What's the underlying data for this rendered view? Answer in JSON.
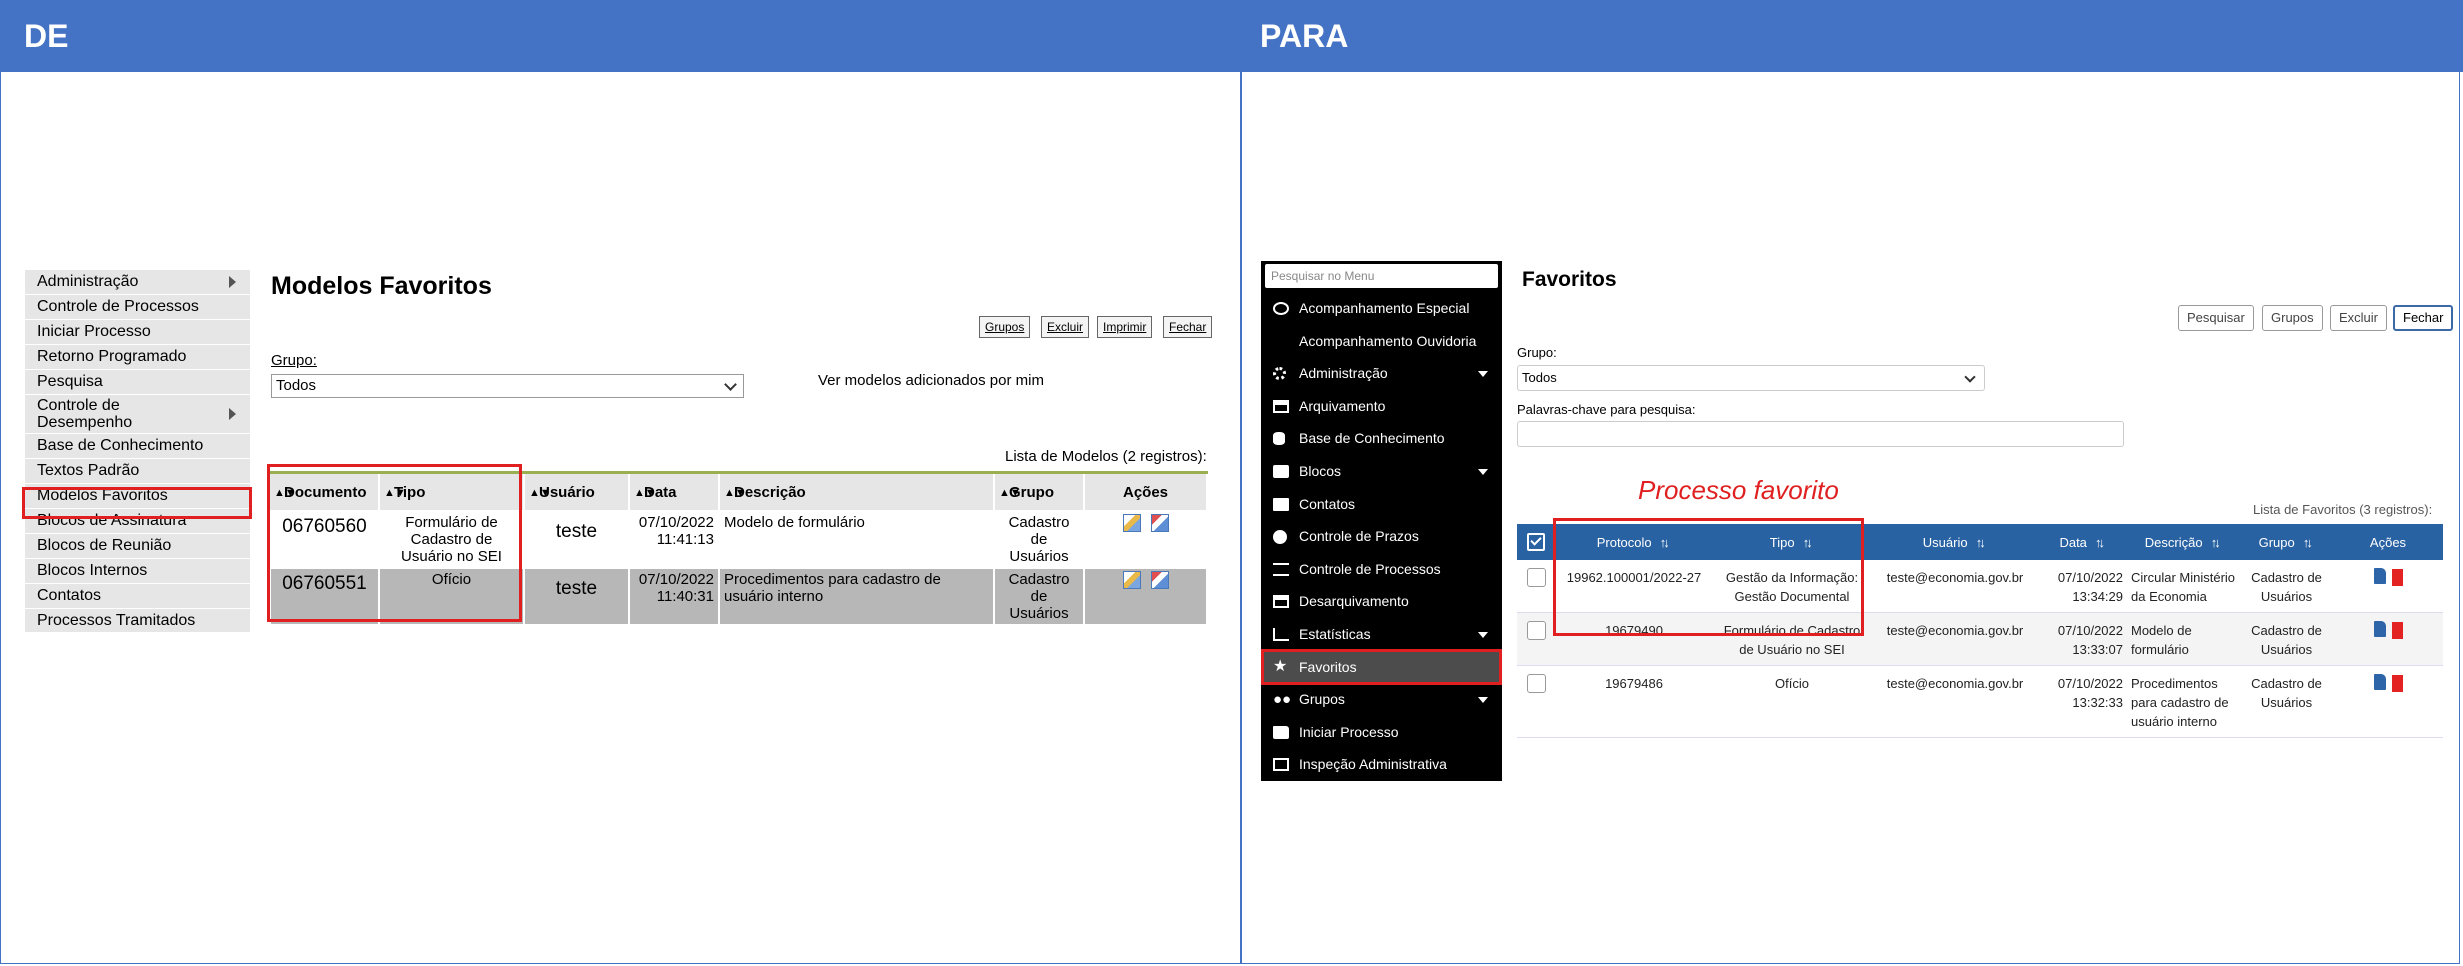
{
  "headers": {
    "left": "DE",
    "right": "PARA"
  },
  "old_ui": {
    "menu": [
      {
        "label": "Administração",
        "submenu": true
      },
      {
        "label": "Controle de Processos"
      },
      {
        "label": "Iniciar Processo"
      },
      {
        "label": "Retorno Programado"
      },
      {
        "label": "Pesquisa"
      },
      {
        "label": "Controle de Desempenho",
        "submenu": true
      },
      {
        "label": "Base de Conhecimento"
      },
      {
        "label": "Textos Padrão"
      },
      {
        "label": "Modelos Favoritos",
        "highlighted": true
      },
      {
        "label": "Blocos de Assinatura"
      },
      {
        "label": "Blocos de Reunião"
      },
      {
        "label": "Blocos Internos"
      },
      {
        "label": "Contatos"
      },
      {
        "label": "Processos Tramitados"
      }
    ],
    "title": "Modelos Favoritos",
    "buttons": [
      "Grupos",
      "Excluir",
      "Imprimir",
      "Fechar"
    ],
    "group_label": "Grupo:",
    "group_value": "Todos",
    "ver_modelos": "Ver modelos adicionados por mim",
    "caption": "Lista de Modelos (2 registros):",
    "columns": [
      "Documento",
      "Tipo",
      "Usuário",
      "Data",
      "Descrição",
      "Grupo",
      "Ações"
    ],
    "rows": [
      {
        "documento": "06760560",
        "tipo": "Formulário de Cadastro de Usuário no SEI",
        "usuario": "teste",
        "data": "07/10/2022",
        "hora": "11:41:13",
        "descricao": "Modelo de formulário",
        "grupo": "Cadastro de Usuários"
      },
      {
        "documento": "06760551",
        "tipo": "Ofício",
        "usuario": "teste",
        "data": "07/10/2022",
        "hora": "11:40:31",
        "descricao": "Procedimentos para cadastro de usuário interno",
        "grupo": "Cadastro de Usuários"
      }
    ]
  },
  "new_ui": {
    "search_placeholder": "Pesquisar no Menu",
    "menu": [
      {
        "label": "Acompanhamento Especial",
        "icon": "eye-icon"
      },
      {
        "label": "Acompanhamento Ouvidoria",
        "icon": ""
      },
      {
        "label": "Administração",
        "icon": "gears-icon",
        "submenu": true
      },
      {
        "label": "Arquivamento",
        "icon": "archive-icon"
      },
      {
        "label": "Base de Conhecimento",
        "icon": "database-icon"
      },
      {
        "label": "Blocos",
        "icon": "briefcase-icon",
        "submenu": true
      },
      {
        "label": "Contatos",
        "icon": "contact-card-icon"
      },
      {
        "label": "Controle de Prazos",
        "icon": "clock-icon"
      },
      {
        "label": "Controle de Processos",
        "icon": "list-icon"
      },
      {
        "label": "Desarquivamento",
        "icon": "unarchive-icon"
      },
      {
        "label": "Estatísticas",
        "icon": "chart-icon",
        "submenu": true
      },
      {
        "label": "Favoritos",
        "icon": "star-icon",
        "selected": true
      },
      {
        "label": "Grupos",
        "icon": "users-icon",
        "submenu": true
      },
      {
        "label": "Iniciar Processo",
        "icon": "folder-icon"
      },
      {
        "label": "Inspeção Administrativa",
        "icon": "inspect-icon"
      }
    ],
    "title": "Favoritos",
    "buttons": [
      "Pesquisar",
      "Grupos",
      "Excluir",
      "Fechar"
    ],
    "group_label": "Grupo:",
    "group_value": "Todos",
    "keywords_label": "Palavras-chave para pesquisa:",
    "annotation": "Processo favorito",
    "caption": "Lista de Favoritos (3 registros):",
    "columns": [
      "Protocolo",
      "Tipo",
      "Usuário",
      "Data",
      "Descrição",
      "Grupo",
      "Ações"
    ],
    "rows": [
      {
        "protocolo": "19962.100001/2022-27",
        "tipo": "Gestão da Informação: Gestão Documental",
        "usuario": "teste@economia.gov.br",
        "data": "07/10/2022",
        "hora": "13:34:29",
        "descricao": "Circular Ministério da Economia",
        "grupo": "Cadastro de Usuários"
      },
      {
        "protocolo": "19679490",
        "tipo": "Formulário de Cadastro de Usuário no SEI",
        "usuario": "teste@economia.gov.br",
        "data": "07/10/2022",
        "hora": "13:33:07",
        "descricao": "Modelo de formulário",
        "grupo": "Cadastro de Usuários"
      },
      {
        "protocolo": "19679486",
        "tipo": "Ofício",
        "usuario": "teste@economia.gov.br",
        "data": "07/10/2022",
        "hora": "13:32:33",
        "descricao": "Procedimentos para cadastro de usuário interno",
        "grupo": "Cadastro de Usuários"
      }
    ]
  }
}
